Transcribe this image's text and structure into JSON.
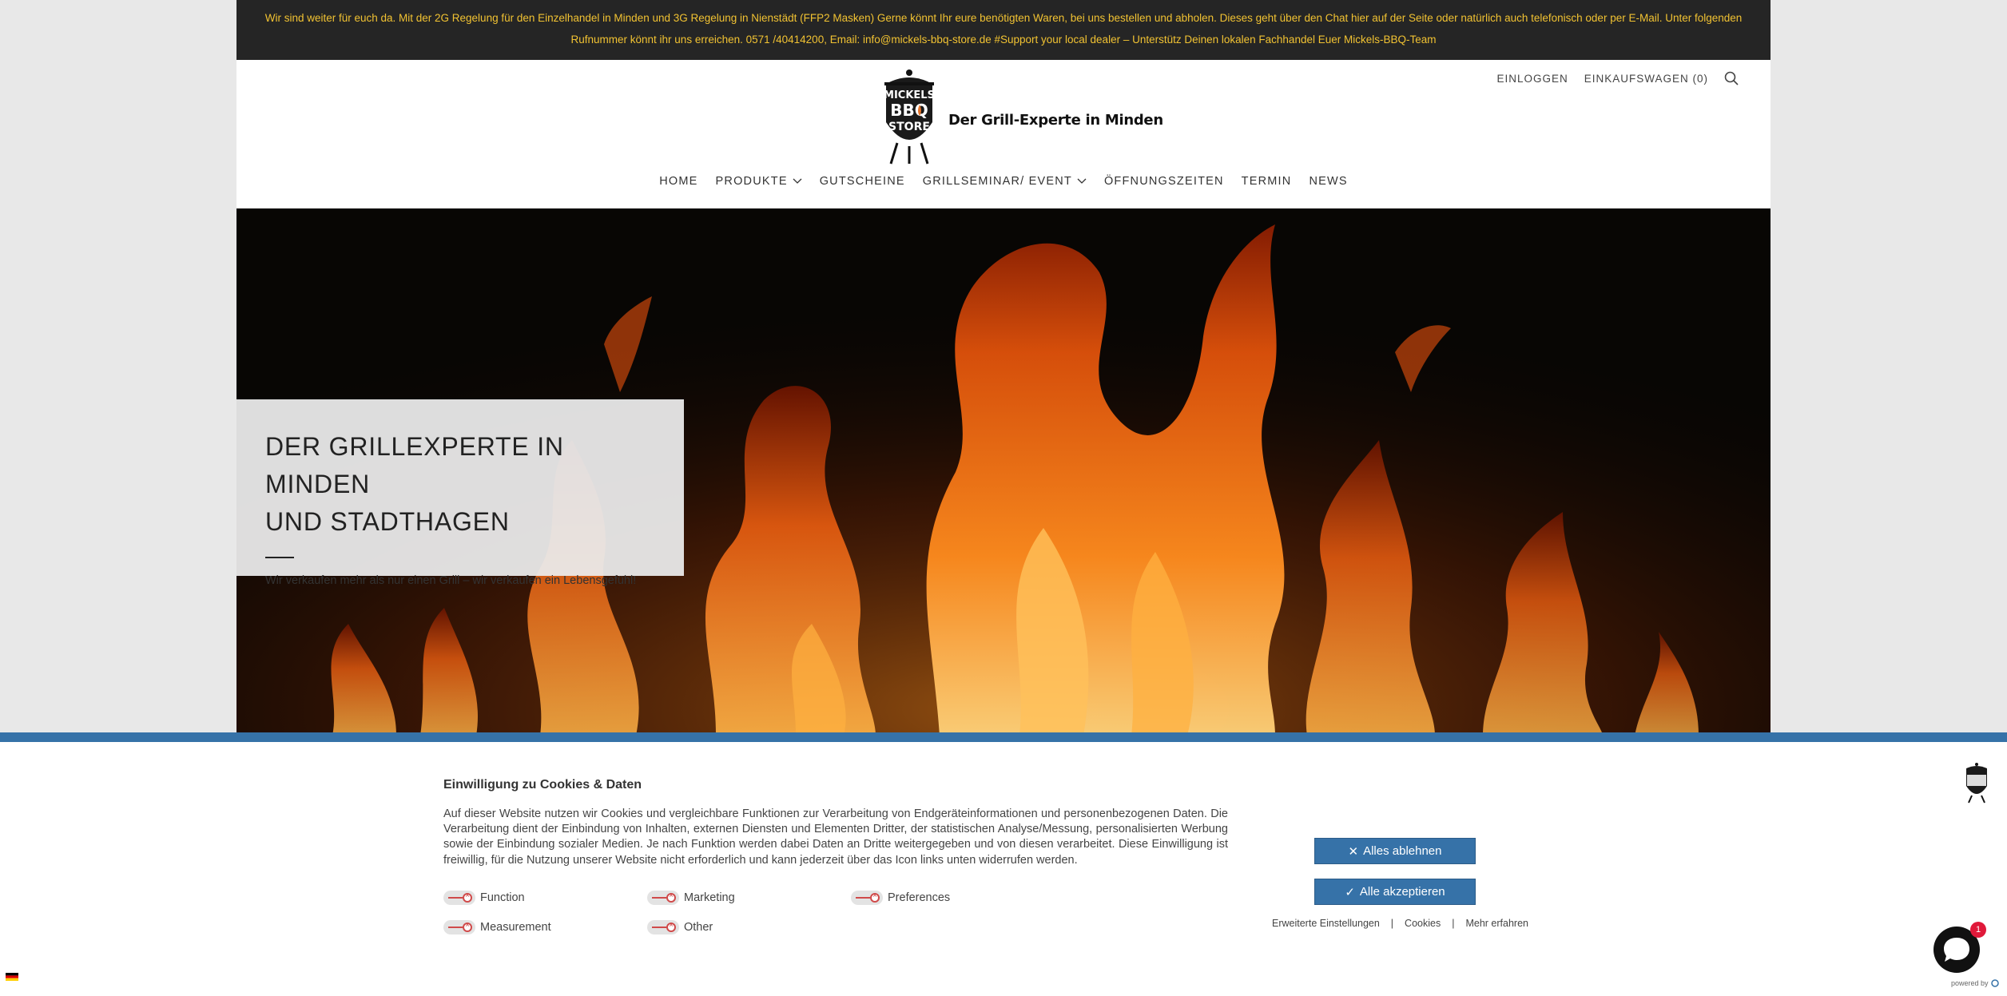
{
  "announcement": {
    "line1": "Wir sind weiter für euch da. Mit der 2G Regelung für den Einzelhandel in Minden und 3G Regelung in Nienstädt (FFP2 Masken) Gerne könnt Ihr eure benötigten Waren, bei uns bestellen und abholen. Dieses geht über den Chat hier auf der Seite oder natürlich auch telefonisch oder per E-Mail. Unter folgenden",
    "line2": "Rufnummer könnt ihr uns erreichen. 0571 /40414200, Email: info@mickels-bbq-store.de #Support your local dealer – Unterstütz Deinen lokalen Fachhandel Euer Mickels-BBQ-Team"
  },
  "header": {
    "logo_top": "MICKELS",
    "logo_mid": "BBQ",
    "logo_bottom": "STORE",
    "tagline": "Der Grill-Experte in Minden",
    "login_label": "EINLOGGEN",
    "cart_label": "EINKAUFSWAGEN (0)"
  },
  "nav": [
    {
      "label": "HOME"
    },
    {
      "label": "PRODUKTE"
    },
    {
      "label": "GUTSCHEINE"
    },
    {
      "label": "GRILLSEMINAR/ EVENT"
    },
    {
      "label": "ÖFFNUNGSZEITEN"
    },
    {
      "label": "TERMIN"
    },
    {
      "label": "NEWS"
    }
  ],
  "hero": {
    "title_line1": "DER GRILLEXPERTE IN MINDEN",
    "title_line2": "UND STADTHAGEN",
    "subtitle": "Wir verkaufen mehr als nur einen Grill – wir verkaufen ein Lebensgefühl!"
  },
  "cookie": {
    "title": "Einwilligung zu Cookies & Daten",
    "text": "Auf dieser Website nutzen wir Cookies und vergleichbare Funktionen zur Verarbeitung von Endgeräteinformationen und personenbezogenen Daten. Die Verarbeitung dient der Einbindung von Inhalten, externen Diensten und Elementen Dritter, der statistischen Analyse/Messung, personalisierten Werbung sowie der Einbindung sozialer Medien. Je nach Funktion werden dabei Daten an Dritte weitergegeben und von diesen verarbeitet. Diese Einwilligung ist freiwillig, für die Nutzung unserer Website nicht erforderlich und kann jederzeit über das Icon links unten widerrufen werden.",
    "toggles": {
      "function": "Function",
      "marketing": "Marketing",
      "preferences": "Preferences",
      "measurement": "Measurement",
      "other": "Other"
    },
    "reject_label": "Alles ablehnen",
    "accept_label": "Alle akzeptieren",
    "links": {
      "advanced": "Erweiterte Einstellungen",
      "cookies": "Cookies",
      "more": "Mehr erfahren"
    },
    "accent_color": "#3672a8"
  },
  "chat": {
    "badge_count": "1",
    "powered_by": "powered by"
  }
}
